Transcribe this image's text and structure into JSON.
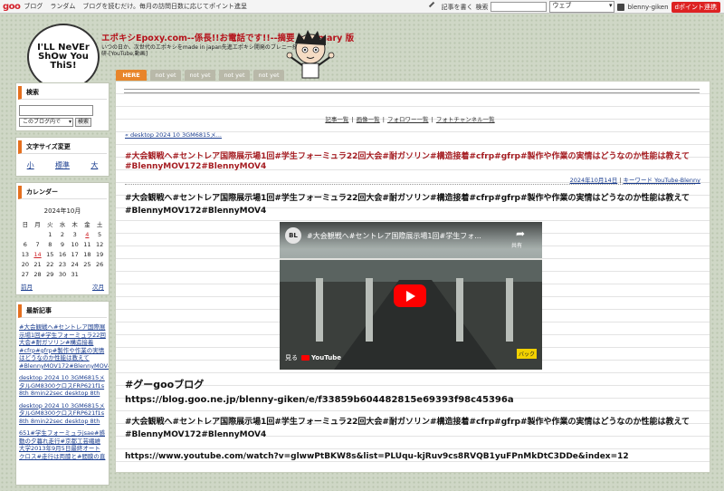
{
  "topbar": {
    "logo": "goo",
    "links": [
      "ブログ",
      "ランダム",
      "ブログを読むだけ。毎月の訪問日数に応じてポイント進呈"
    ],
    "write_label": "記事を書く",
    "search_label": "検索",
    "search_value": "",
    "search_scope": "ウェブ",
    "username": "blenny-giken",
    "point_button": "dポイント連携"
  },
  "header": {
    "logo_lines": [
      "I'LL NeVEr",
      "ShOw You",
      "ThiS!"
    ],
    "title": "エポキシEpoxy.com--係長!!お電話です!!--摘要 summary 版",
    "description": "いつの日か、次世代のエポキシをmade in japan先進エポキシ開発のブレニー技研-[YouTube,動画]"
  },
  "tabs": [
    "HERE",
    "not yet",
    "not yet",
    "not yet",
    "not yet"
  ],
  "sidebar": {
    "search": {
      "heading": "検索",
      "scope": "このブログ内で",
      "button": "検索"
    },
    "fontsize": {
      "heading": "文字サイズ変更",
      "options": [
        "小",
        "標準",
        "大"
      ]
    },
    "calendar": {
      "heading": "カレンダー",
      "month": "2024年10月",
      "weekdays": [
        "日",
        "月",
        "火",
        "水",
        "木",
        "金",
        "土"
      ],
      "weeks": [
        [
          "",
          "",
          "1",
          "2",
          "3",
          "4",
          "5"
        ],
        [
          "6",
          "7",
          "8",
          "9",
          "10",
          "11",
          "12"
        ],
        [
          "13",
          "14",
          "15",
          "16",
          "17",
          "18",
          "19"
        ],
        [
          "20",
          "21",
          "22",
          "23",
          "24",
          "25",
          "26"
        ],
        [
          "27",
          "28",
          "29",
          "30",
          "31",
          "",
          ""
        ]
      ],
      "prev": "前月",
      "next": "次月",
      "highlight_color": "#d0262c"
    },
    "recent": {
      "heading": "最新記事",
      "items": [
        "#大会観戦へ#セントレア国際展示場1回#学生フォーミュラ22回大会#耐ガソリン#構造接着#cfrp#gfrp#製作や作業の実情はどうなのか性能は教えて#BlennyMOV172#BlennyMOV4",
        "desktop 2024 10 3GM6815メタルGM8300クロスFRP621f1s 8th 8min22sec desktop 8th",
        "desktop 2024 10 3GM6815メタルGM8300クロスFRP621f1s 8th 8min22sec desktop 8th",
        "651#学生フォーミュラjsae#感動の夕暮れ走行#京都工芸繊維大学2013年9月5日最終オートクロス#走行は両膝と#間膜の直"
      ]
    }
  },
  "main": {
    "nav_links": [
      "記事一覧",
      "画像一覧",
      "フォロワー一覧",
      "フォトチャンネル一覧"
    ],
    "breadcrumb": "« desktop 2024 10 3GM6815メ...",
    "entry_title": "#大会観戦へ#セントレア国際展示場1回#学生フォーミュラ22回大会#耐ガソリン#構造接着#cfrp#gfrp#製作や作業の実情はどうなのか性能は教えて#BlennyMOV172#BlennyMOV4",
    "entry_date": "2024年10月14日",
    "entry_keyword": "キーワード YouTube-Blenny",
    "body_title": "#大会観戦へ#セントレア国際展示場1回#学生フォーミュラ22回大会#耐ガソリン#構造接着#cfrp#gfrp#製作や作業の実情はどうなのか性能は教えて#BlennyMOV172#BlennyMOV4",
    "video": {
      "channel_initials": "BL",
      "title": "#大会観戦へ#セントレア国際展示場1回#学生フォ...",
      "share_label": "共有",
      "watch_on": "見る",
      "yt_logo": "YouTube",
      "road_sign": "バック"
    },
    "goo_heading": "#グーgooブログ",
    "goo_url": "https://blog.goo.ne.jp/blenny-giken/e/f33859b604482815e69393f98c45396a",
    "body_title2": "#大会観戦へ#セントレア国際展示場1回#学生フォーミュラ22回大会#耐ガソリン#構造接着#cfrp#gfrp#製作や作業の実情はどうなのか性能は教えて#BlennyMOV172#BlennyMOV4",
    "yt_url": "https://www.youtube.com/watch?v=glwwPtBKW8s&list=PLUqu-kjRuv9cs8RVQB1yuFPnMkDtC3DDe&index=12"
  },
  "colors": {
    "accent_orange": "#e5701f",
    "title_red": "#b5121b",
    "link_blue": "#1a3d8f"
  }
}
